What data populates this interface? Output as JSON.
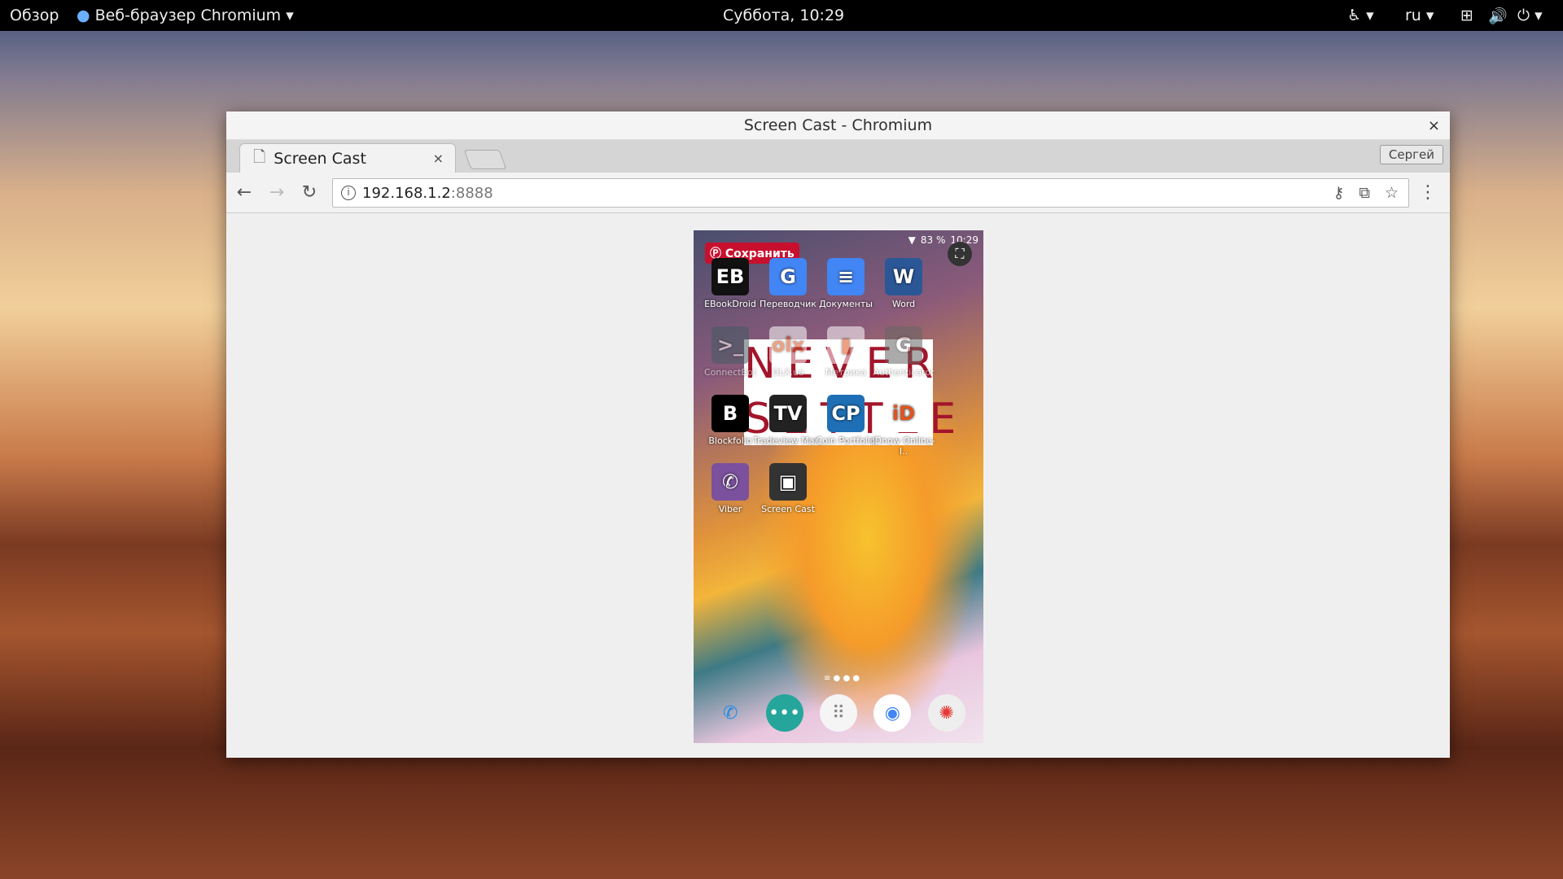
{
  "topbar": {
    "overview": "Обзор",
    "app_menu": "Веб-браузер Chromium",
    "clock": "Суббота, 10:29",
    "lang": "ru"
  },
  "window": {
    "title": "Screen Cast - Chromium",
    "close": "×"
  },
  "tab": {
    "label": "Screen Cast",
    "close": "×"
  },
  "profile": "Сергей",
  "address": {
    "host": "192.168.1.2",
    "port": ":8888"
  },
  "phone": {
    "status": {
      "battery": "83 %",
      "time": "10:29"
    },
    "save_label": "Сохранить",
    "banner": {
      "line1": "NEVER",
      "line2": "SETTLE"
    },
    "apps": [
      {
        "label": "EBookDroid",
        "glyph": "EB",
        "color": "#111"
      },
      {
        "label": "Переводчик",
        "glyph": "G",
        "color": "#4285f4"
      },
      {
        "label": "Документы",
        "glyph": "≡",
        "color": "#4285f4"
      },
      {
        "label": "Word",
        "glyph": "W",
        "color": "#2b5797"
      },
      {
        "label": "ConnectBot",
        "glyph": ">_",
        "color": "#455a64"
      },
      {
        "label": "OLX.ua",
        "glyph": "olx",
        "color": "#fff"
      },
      {
        "label": "Метрика",
        "glyph": "▮",
        "color": "#fff"
      },
      {
        "label": "Authenticator",
        "glyph": "G",
        "color": "#666"
      },
      {
        "label": "Blockfolio",
        "glyph": "B",
        "color": "#000"
      },
      {
        "label": "Tradeview Mar..",
        "glyph": "TV",
        "color": "#222"
      },
      {
        "label": "Coin Portfolio",
        "glyph": "CP",
        "color": "#1e6fb5"
      },
      {
        "label": "IDnow Online-I..",
        "glyph": "iD",
        "color": "#fff"
      },
      {
        "label": "Viber",
        "glyph": "✆",
        "color": "#7b519d"
      },
      {
        "label": "Screen Cast",
        "glyph": "▣",
        "color": "#333"
      }
    ],
    "dock": [
      {
        "name": "phone",
        "glyph": "✆"
      },
      {
        "name": "messages",
        "glyph": "•••"
      },
      {
        "name": "apps",
        "glyph": "⠿"
      },
      {
        "name": "chrome",
        "glyph": "◉"
      },
      {
        "name": "camera",
        "glyph": "✺"
      }
    ]
  }
}
